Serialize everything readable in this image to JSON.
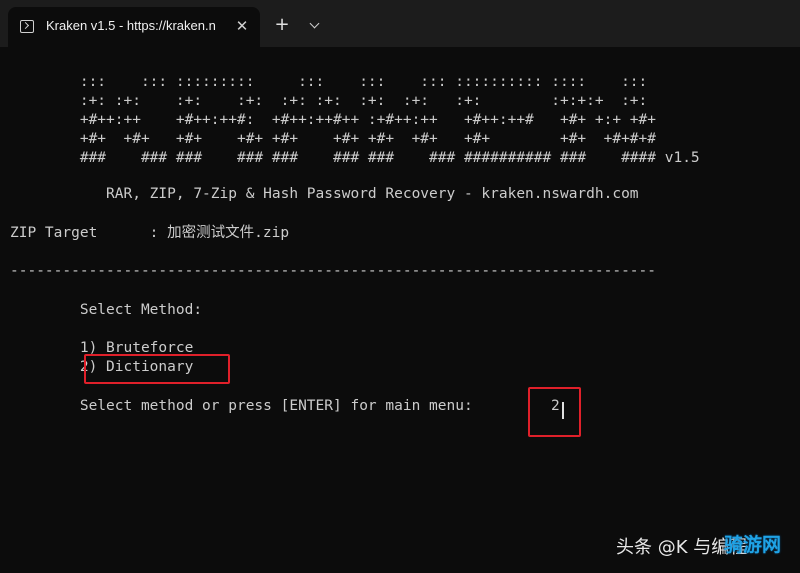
{
  "window": {
    "tab_title": "Kraken v1.5 - https://kraken.n",
    "close_glyph": "✕",
    "new_tab_glyph": "+"
  },
  "terminal": {
    "banner": [
      "        :::    ::: :::::::::     :::    :::    ::: :::::::::: ::::    :::",
      "        :+: :+:    :+:    :+:  :+: :+:  :+:  :+:   :+:        :+:+:+  :+:",
      "        +#++:++    +#++:++#:  +#++:++#++ :+#++:++   +#++:++#   +#+ +:+ +#+",
      "        +#+  +#+   +#+    +#+ +#+    +#+ +#+  +#+   +#+        +#+  +#+#+#",
      "        ###    ### ###    ### ###    ### ###    ### ########## ###    #### v1.5"
    ],
    "subtitle": "           RAR, ZIP, 7-Zip & Hash Password Recovery - kraken.nswardh.com",
    "target_line": "ZIP Target      : 加密测试文件.zip",
    "separator": "--------------------------------------------------------------------------",
    "select_heading": "        Select Method:",
    "options": [
      "        1) Bruteforce",
      "        2) Dictionary"
    ],
    "prompt": "        Select method or press [ENTER] for main menu: ",
    "input_value": "2"
  },
  "watermark": {
    "text": "头条 @K  与编程",
    "logo": "骑游网"
  },
  "colors": {
    "background": "#0c0c0c",
    "titlebar": "#1c1c1c",
    "text": "#cccccc",
    "highlight": "#e0202a"
  }
}
